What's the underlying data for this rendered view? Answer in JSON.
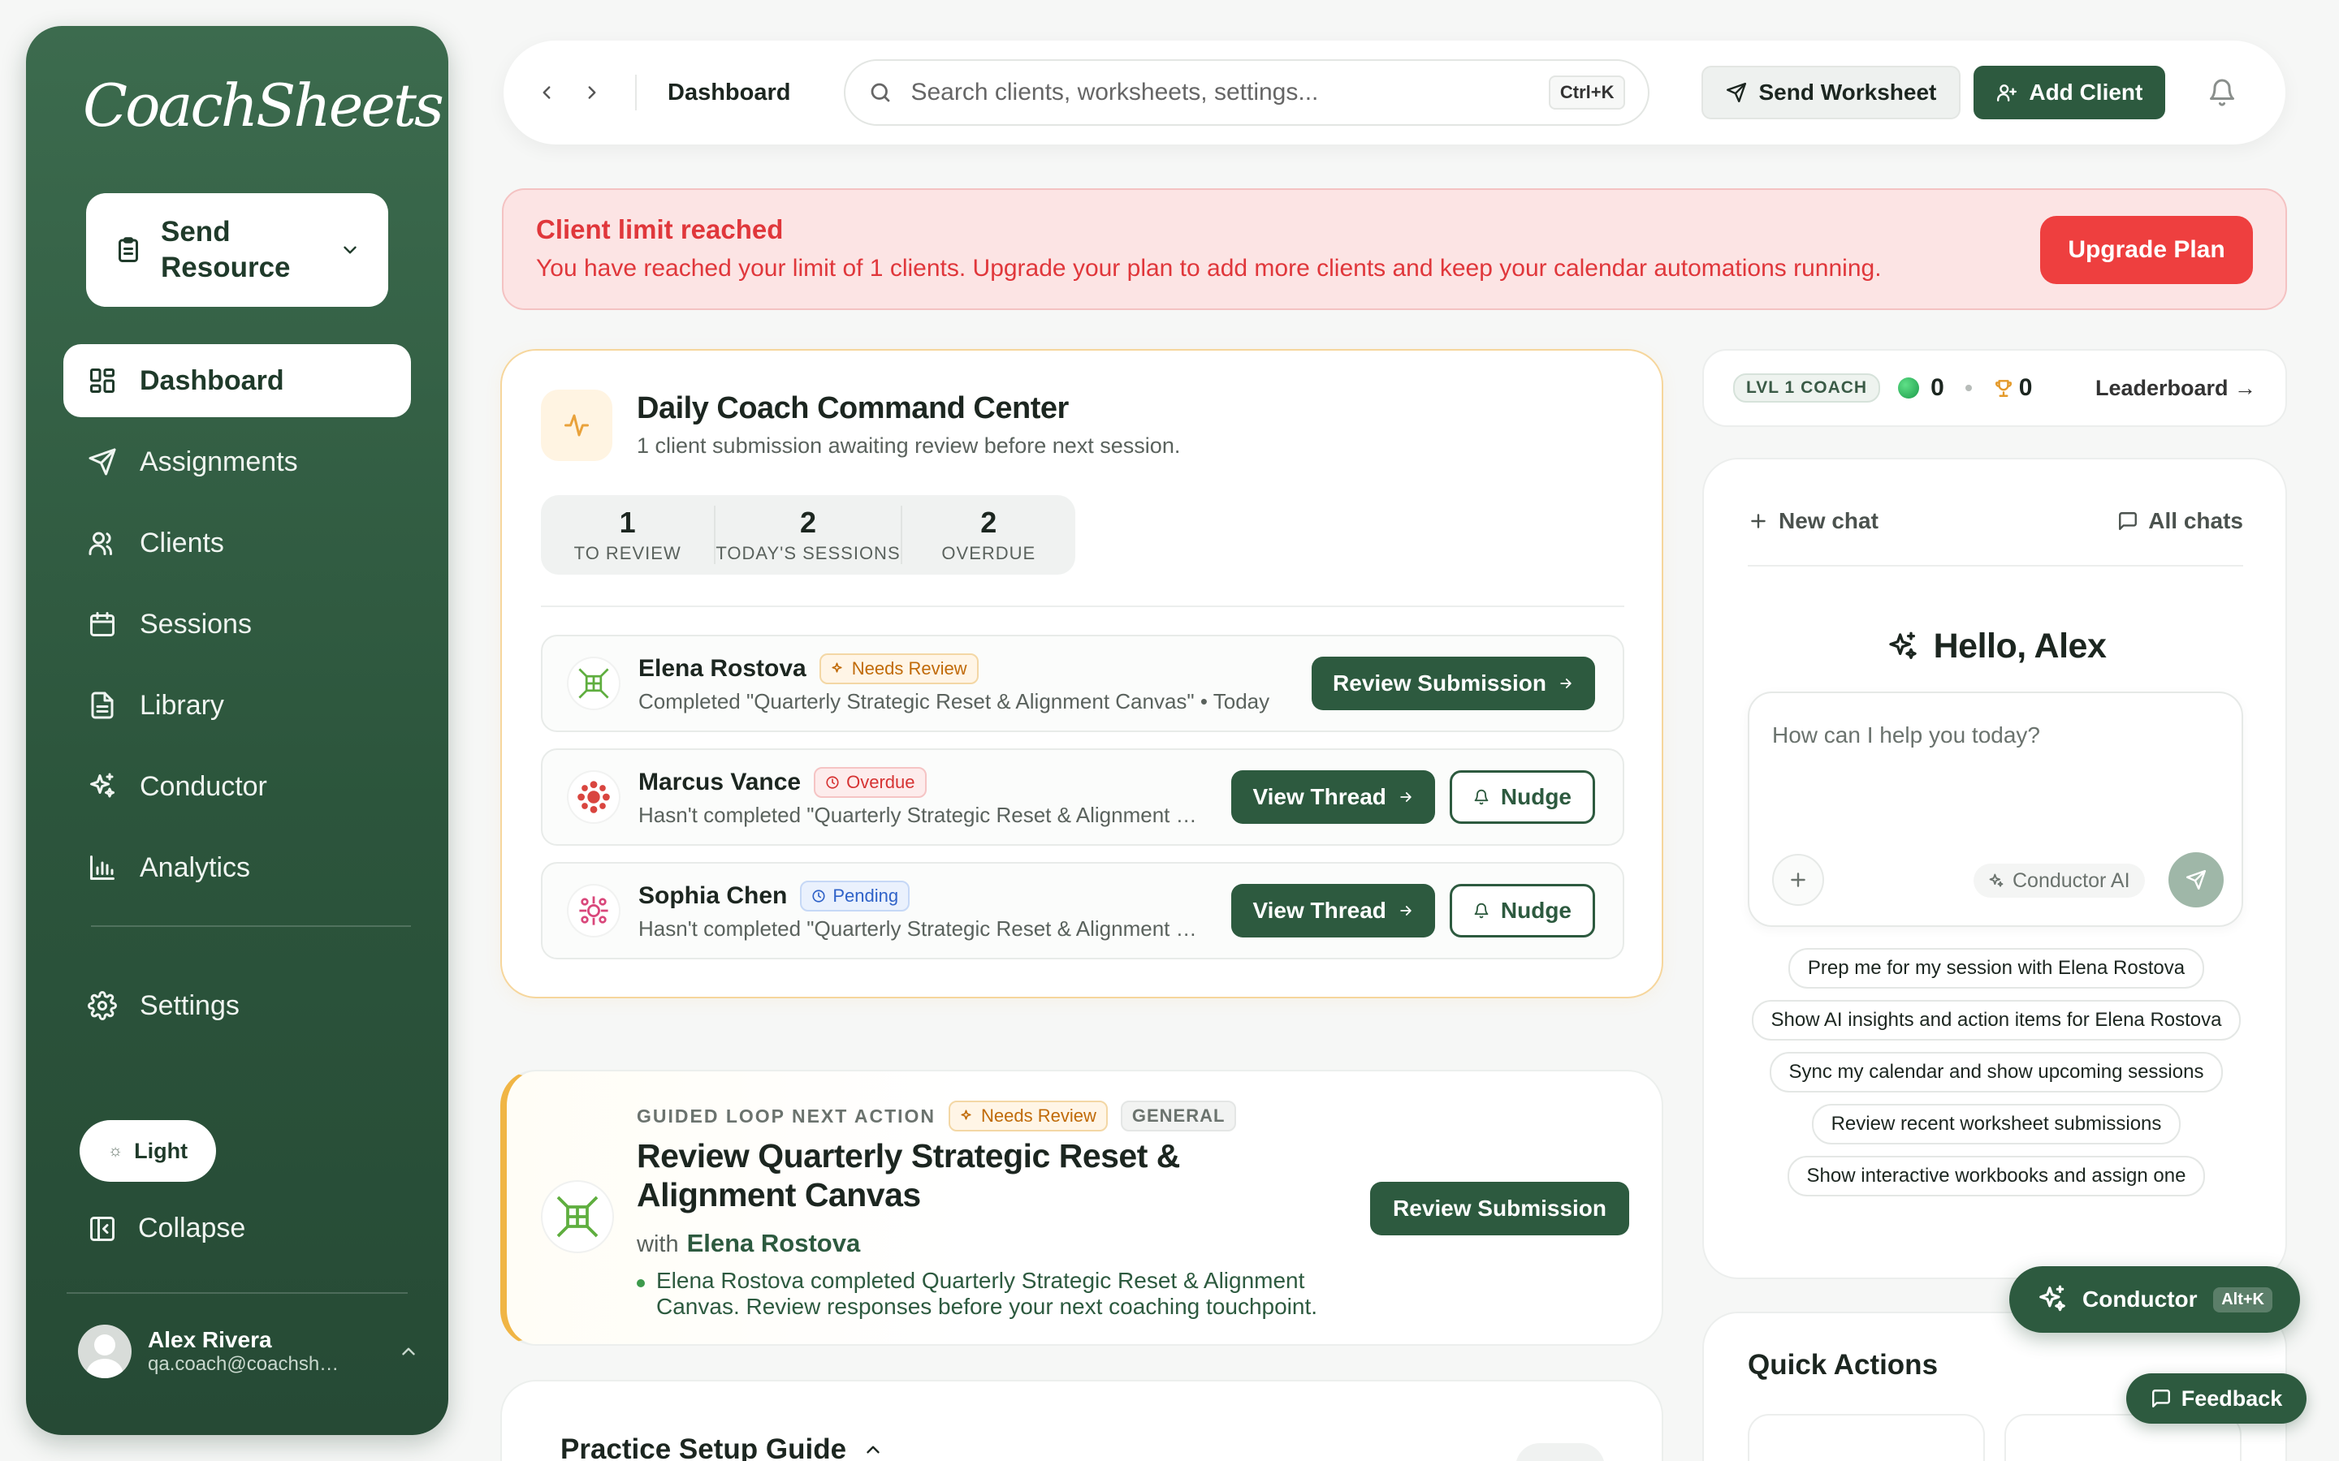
{
  "brand": {
    "logo_text": "CoachSheets"
  },
  "sidebar": {
    "send_resource_label": "Send Resource",
    "items": [
      {
        "label": "Dashboard",
        "icon": "dashboard-icon",
        "active": true
      },
      {
        "label": "Assignments",
        "icon": "send-icon"
      },
      {
        "label": "Clients",
        "icon": "users-icon"
      },
      {
        "label": "Sessions",
        "icon": "calendar-icon"
      },
      {
        "label": "Library",
        "icon": "document-icon"
      },
      {
        "label": "Conductor",
        "icon": "sparkles-icon"
      },
      {
        "label": "Analytics",
        "icon": "bar-chart-icon"
      }
    ],
    "settings_label": "Settings",
    "theme_label": "Light",
    "collapse_label": "Collapse",
    "user": {
      "name": "Alex Rivera",
      "email": "qa.coach@coachsheets.com"
    }
  },
  "topbar": {
    "breadcrumb": "Dashboard",
    "search_placeholder": "Search clients, worksheets, settings...",
    "search_shortcut": "Ctrl+K",
    "send_worksheet_label": "Send Worksheet",
    "add_client_label": "Add Client"
  },
  "alert": {
    "title": "Client limit reached",
    "message": "You have reached your limit of 1 clients. Upgrade your plan to add more clients and keep your calendar automations running.",
    "button": "Upgrade Plan"
  },
  "command_center": {
    "title": "Daily Coach Command Center",
    "subtitle": "1 client submission awaiting review before next session.",
    "stats": [
      {
        "value": "1",
        "label": "TO REVIEW"
      },
      {
        "value": "2",
        "label": "TODAY'S SESSIONS"
      },
      {
        "value": "2",
        "label": "OVERDUE"
      }
    ],
    "rows": [
      {
        "name": "Elena Rostova",
        "status": "Needs Review",
        "description": "Completed \"Quarterly Strategic Reset & Alignment Canvas\" • Today",
        "primary": "Review Submission"
      },
      {
        "name": "Marcus Vance",
        "status": "Overdue",
        "description": "Hasn't completed \"Quarterly Strategic Reset & Alignment Canvas\"",
        "primary": "View Thread",
        "secondary": "Nudge"
      },
      {
        "name": "Sophia Chen",
        "status": "Pending",
        "description": "Hasn't completed \"Quarterly Strategic Reset & Alignment Canvas\"",
        "primary": "View Thread",
        "secondary": "Nudge"
      }
    ]
  },
  "guided": {
    "kicker": "GUIDED LOOP NEXT ACTION",
    "status": "Needs Review",
    "category": "GENERAL",
    "title": "Review Quarterly Strategic Reset & Alignment Canvas",
    "with_label": "with",
    "client": "Elena Rostova",
    "note": "Elena Rostova completed Quarterly Strategic Reset & Alignment Canvas. Review responses before your next coaching touchpoint.",
    "button": "Review Submission"
  },
  "practice": {
    "title": "Practice Setup Guide"
  },
  "level": {
    "badge": "LVL 1 COACH",
    "gems": "0",
    "trophies": "0",
    "leaderboard": "Leaderboard →"
  },
  "chat": {
    "new_chat": "New chat",
    "all_chats": "All chats",
    "greeting": "Hello, Alex",
    "placeholder": "How can I help you today?",
    "model": "Conductor AI",
    "suggestions": [
      "Prep me for my session with Elena Rostova",
      "Show AI insights and action items for Elena Rostova",
      "Sync my calendar and show upcoming sessions",
      "Review recent worksheet submissions",
      "Show interactive workbooks and assign one"
    ]
  },
  "quick_actions": {
    "title": "Quick Actions"
  },
  "fab": {
    "label": "Conductor",
    "shortcut": "Alt+K"
  },
  "feedback": {
    "label": "Feedback"
  },
  "colors": {
    "primary": "#2d5a3f",
    "alert": "#ee3f3f",
    "review": "#c06a08",
    "overdue": "#d63333",
    "pending": "#2f62c8"
  }
}
